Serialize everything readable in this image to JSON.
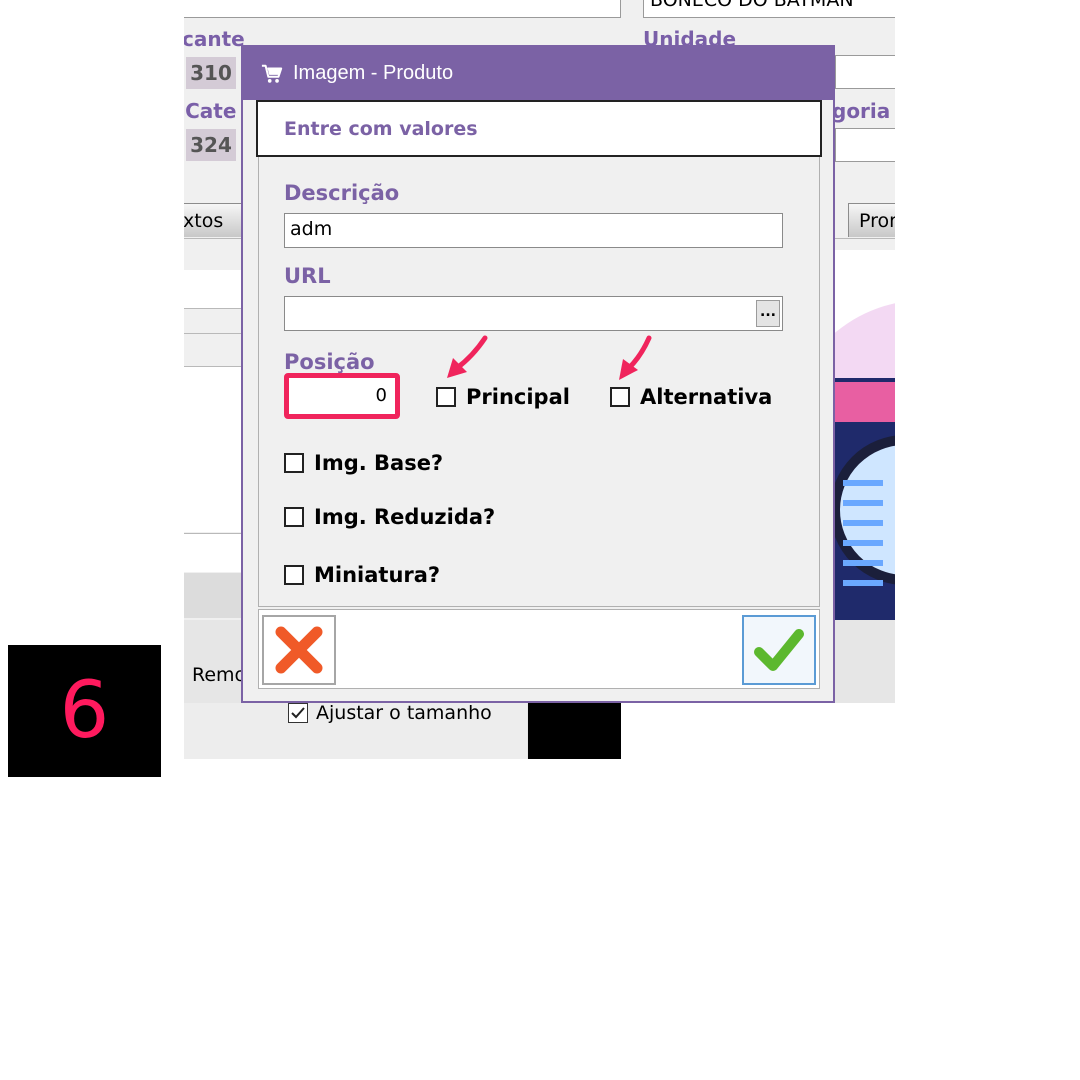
{
  "step_number": "6",
  "background_app": {
    "product_name_value": "BONECO DO BATMAN",
    "fabricante_label": "cante",
    "fabricante_code": "310",
    "unidade_label": "Unidade",
    "categoria_label_left": "' Cate",
    "categoria_code": "324",
    "categoria_label_right": "goria",
    "tab_left_label": "xtos",
    "tab_right_label": "Pror",
    "remove_label": "Remo",
    "ajustar_checkbox_label": "Ajustar o tamanho",
    "ajustar_checked": true
  },
  "dialog": {
    "title": "Imagem - Produto",
    "header": "Entre com valores",
    "descricao_label": "Descrição",
    "descricao_value": "adm",
    "url_label": "URL",
    "url_value": "",
    "url_button": "...",
    "posicao_label": "Posição",
    "posicao_value": "0",
    "checkboxes": {
      "principal": "Principal",
      "alternativa": "Alternativa",
      "img_base": "Img. Base?",
      "img_reduzida": "Img. Reduzida?",
      "miniatura": "Miniatura?"
    },
    "cancel_icon": "red-x-icon",
    "ok_icon": "green-check-icon"
  },
  "colors": {
    "accent": "#7b62a5",
    "highlight": "#f0245c",
    "cancel": "#f05a28",
    "ok": "#5cb82e"
  }
}
